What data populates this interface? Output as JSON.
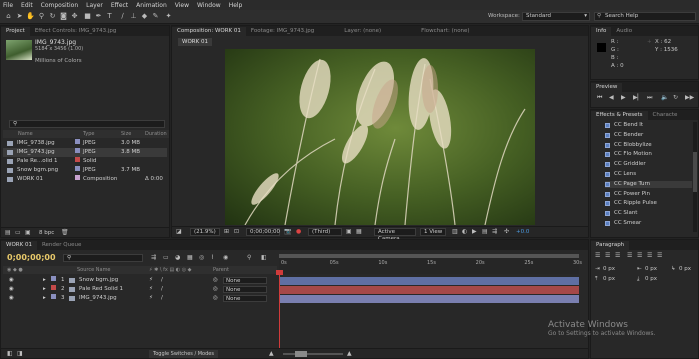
{
  "menu": [
    "File",
    "Edit",
    "Composition",
    "Layer",
    "Effect",
    "Animation",
    "View",
    "Window",
    "Help"
  ],
  "toolbar": {
    "workspace_label": "Workspace:",
    "workspace_value": "Standard",
    "search_placeholder": "Search Help"
  },
  "project": {
    "tabs": [
      "Project",
      "Effect Controls: IMG_9743.jpg"
    ],
    "asset_name": "IMG_9743.jpg",
    "asset_dims": "5184 x 3456 (1.00)",
    "asset_colors": "Millions of Colors",
    "columns": {
      "name": "Name",
      "type": "Type",
      "size": "Size",
      "duration": "Duration"
    },
    "items": [
      {
        "name": "IMG_9738.jpg",
        "type": "JPEG",
        "size": "3.0 MB",
        "duration": "",
        "color": "#8a8fbf"
      },
      {
        "name": "IMG_9743.jpg",
        "type": "JPEG",
        "size": "3.8 MB",
        "duration": "",
        "color": "#8a8fbf"
      },
      {
        "name": "Pale Re...olid 1",
        "type": "Solid",
        "size": "",
        "duration": "",
        "color": "#c44a4a"
      },
      {
        "name": "Snow bgm.png",
        "type": "JPEG",
        "size": "3.7 MB",
        "duration": "",
        "color": "#8a8fbf"
      },
      {
        "name": "WORK 01",
        "type": "Composition",
        "size": "",
        "duration": "Δ 0:00",
        "color": "#c8a2d0"
      }
    ],
    "bpc": "8 bpc"
  },
  "composition": {
    "tabs": [
      "Composition: WORK 01",
      "Footage: IMG_9743.jpg",
      "Layer: (none)",
      "Flowchart: (none)"
    ],
    "crumb": "WORK 01",
    "zoom": "(21.9%)",
    "timecode": "0;00;00;00",
    "resolution": "(Third)",
    "camera": "Active Camera",
    "views": "1 View",
    "exposure": "+0.0"
  },
  "info": {
    "tabs": [
      "Info",
      "Audio"
    ],
    "r": "R :",
    "g": "G :",
    "b": "B :",
    "a": "A : 0",
    "x": "X : 62",
    "y": "Y : 1536"
  },
  "preview": {
    "title": "Preview"
  },
  "effects": {
    "tabs": [
      "Effects & Presets",
      "Characte"
    ],
    "items": [
      "CC Bend It",
      "CC Bender",
      "CC Blobbylize",
      "CC Flo Motion",
      "CC Griddler",
      "CC Lens",
      "CC Page Turn",
      "CC Power Pin",
      "CC Ripple Pulse",
      "CC Slant",
      "CC Smear"
    ]
  },
  "paragraph": {
    "tabs": [
      "Paragraph"
    ],
    "values": [
      "0 px",
      "0 px",
      "0 px",
      "0 px",
      "0 px"
    ]
  },
  "timeline": {
    "tabs": [
      "WORK 01",
      "Render Queue"
    ],
    "timecode": "0;00;00;00",
    "columns": {
      "source": "Source Name",
      "parent": "Parent"
    },
    "ruler": [
      "0s",
      "05s",
      "10s",
      "15s",
      "20s",
      "25s",
      "30s"
    ],
    "layers": [
      {
        "num": "1",
        "name": "Snow bgm.jpg",
        "parent": "None",
        "color": "#8a8fbf",
        "bar": "#5f6fa3"
      },
      {
        "num": "2",
        "name": "Pale Red Solid 1",
        "parent": "None",
        "color": "#c44a4a",
        "bar": "#a54848"
      },
      {
        "num": "3",
        "name": "IMG_9743.jpg",
        "parent": "None",
        "color": "#8a8fbf",
        "bar": "#7a7fb0"
      }
    ],
    "toggle": "Toggle Switches / Modes"
  },
  "watermark": {
    "line1": "Activate Windows",
    "line2": "Go to Settings to activate Windows."
  },
  "colors": {
    "accent": "#4c78d4",
    "playhead": "#d03b3b"
  }
}
